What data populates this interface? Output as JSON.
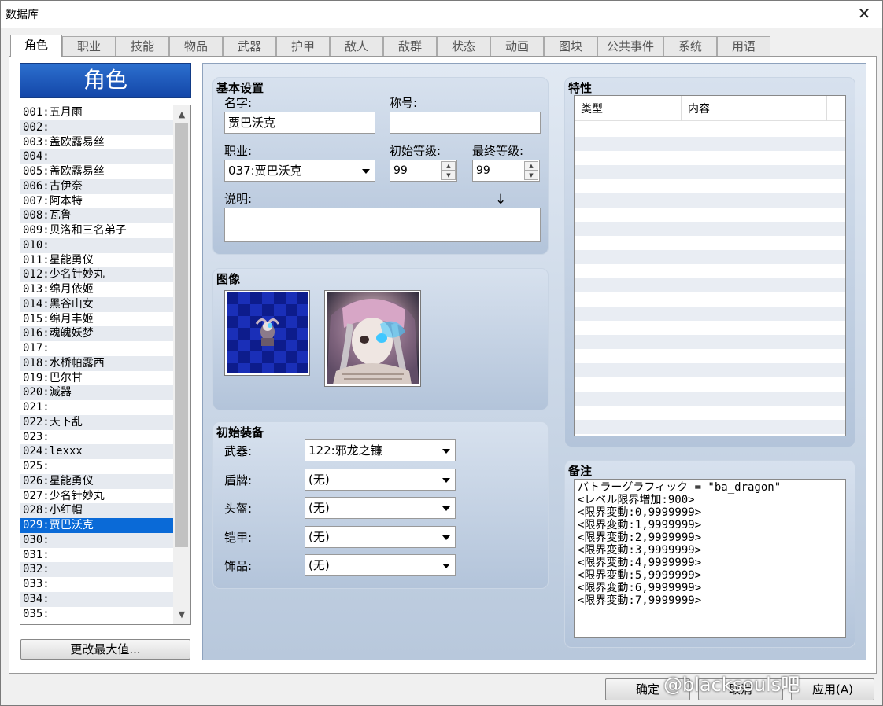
{
  "window": {
    "title": "数据库",
    "close_glyph": "✕"
  },
  "tabs": [
    "角色",
    "职业",
    "技能",
    "物品",
    "武器",
    "护甲",
    "敌人",
    "敌群",
    "状态",
    "动画",
    "图块",
    "公共事件",
    "系统",
    "用语"
  ],
  "left": {
    "header": "角色",
    "items": [
      "001:五月雨",
      "002:",
      "003:盖欧露易丝",
      "004:",
      "005:盖欧露易丝",
      "006:古伊奈",
      "007:阿本特",
      "008:瓦鲁",
      "009:贝洛和三名弟子",
      "010:",
      "011:星能勇仪",
      "012:少名针妙丸",
      "013:绵月依姬",
      "014:黑谷山女",
      "015:绵月丰姬",
      "016:魂魄妖梦",
      "017:",
      "018:水桥帕露西",
      "019:巴尔甘",
      "020:滅器",
      "021:",
      "022:天下乱",
      "023:",
      "024:lexxx",
      "025:",
      "026:星能勇仪",
      "027:少名针妙丸",
      "028:小红帽",
      "029:贾巴沃克",
      "030:",
      "031:",
      "032:",
      "033:",
      "034:",
      "035:"
    ],
    "selected_index": 28,
    "change_max_button": "更改最大值..."
  },
  "basic": {
    "title": "基本设置",
    "name_label": "名字:",
    "name_value": "贾巴沃克",
    "nickname_label": "称号:",
    "nickname_value": "",
    "class_label": "职业:",
    "class_value": "037:贾巴沃克",
    "initial_level_label": "初始等级:",
    "initial_level_value": "99",
    "max_level_label": "最终等级:",
    "max_level_value": "99",
    "description_label": "说明:",
    "description_arrow": "↓",
    "description_value": ""
  },
  "images": {
    "title": "图像"
  },
  "equipment": {
    "title": "初始装备",
    "slots": [
      {
        "label": "武器:",
        "value": "122:邪龙之镰"
      },
      {
        "label": "盾牌:",
        "value": "(无)"
      },
      {
        "label": "头盔:",
        "value": "(无)"
      },
      {
        "label": "铠甲:",
        "value": "(无)"
      },
      {
        "label": "饰品:",
        "value": "(无)"
      }
    ]
  },
  "traits": {
    "title": "特性",
    "columns": [
      "类型",
      "内容"
    ]
  },
  "note": {
    "title": "备注",
    "text": "バトラーグラフィック = \"ba_dragon\"\n<レベル限界増加:900>\n<限界変動:0,9999999>\n<限界変動:1,9999999>\n<限界変動:2,9999999>\n<限界変動:3,9999999>\n<限界変動:4,9999999>\n<限界変動:5,9999999>\n<限界変動:6,9999999>\n<限界変動:7,9999999>"
  },
  "buttons": {
    "ok": "确定",
    "cancel": "取消",
    "apply": "应用(A)"
  },
  "watermark": "@blacksouls吧"
}
